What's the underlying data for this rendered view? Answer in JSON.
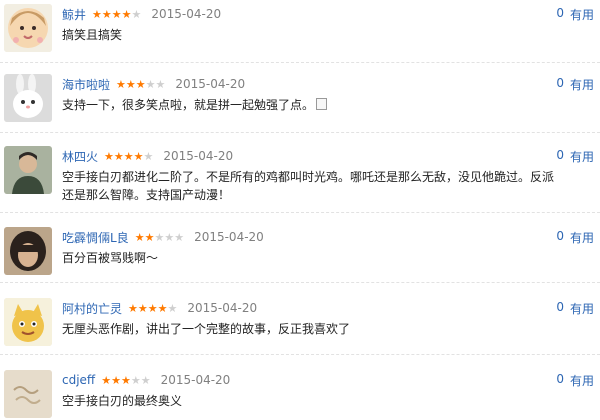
{
  "comments": [
    {
      "username": "鲸井",
      "rating": 4,
      "date": "2015-04-20",
      "text": "搞笑且搞笑",
      "useful_count": "0",
      "useful_label": "有用",
      "avatar": "anime-girl-avatar"
    },
    {
      "username": "海市啦啦",
      "rating": 3,
      "date": "2015-04-20",
      "text": "支持一下，很多笑点啦，就是拼一起勉强了点。",
      "useful_count": "0",
      "useful_label": "有用",
      "avatar": "white-rabbit-avatar"
    },
    {
      "username": "林四火",
      "rating": 4,
      "date": "2015-04-20",
      "text": "空手接白刃都进化二阶了。不是所有的鸡都叫时光鸡。哪吒还是那么无敌，没见他跪过。反派还是那么智障。支持国产动漫！",
      "useful_count": "0",
      "useful_label": "有用",
      "avatar": "man-portrait-avatar"
    },
    {
      "username": "吃霹惆倆L良",
      "rating": 2,
      "date": "2015-04-20",
      "text": "百分百被骂贱啊～",
      "useful_count": "0",
      "useful_label": "有用",
      "avatar": "dark-hair-avatar"
    },
    {
      "username": "阿村的亡灵",
      "rating": 4,
      "date": "2015-04-20",
      "text": "无厘头恶作剧，讲出了一个完整的故事，反正我喜欢了",
      "useful_count": "0",
      "useful_label": "有用",
      "avatar": "cartoon-cat-avatar"
    },
    {
      "username": "cdjeff",
      "rating": 3,
      "date": "2015-04-20",
      "text": "空手接白刃的最终奥义",
      "useful_count": "0",
      "useful_label": "有用",
      "avatar": "beige-sketch-avatar"
    }
  ],
  "star_color": "#ff7a00",
  "link_color": "#2d66b3"
}
